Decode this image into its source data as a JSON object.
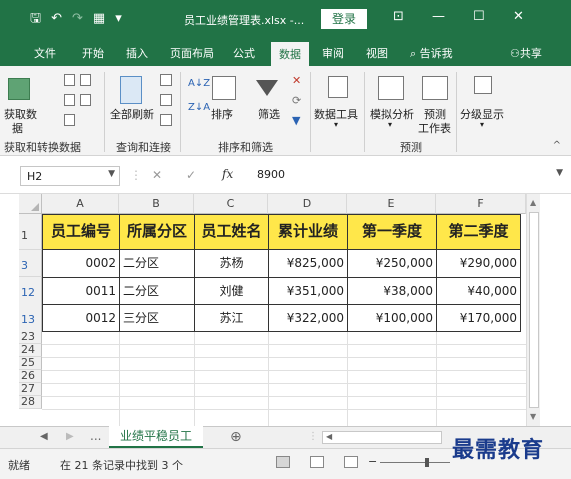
{
  "window": {
    "title": "员工业绩管理表.xlsx  -...",
    "login_label": "登录",
    "ctl_ribbon": "⊡",
    "ctl_minimize": "—",
    "ctl_maximize": "☐",
    "ctl_close": "✕"
  },
  "qat": {
    "save": "🖫",
    "undo": "↶",
    "redo": "↷",
    "open": "▦",
    "customize": "▾"
  },
  "tabs": [
    "文件",
    "开始",
    "插入",
    "页面布局",
    "公式",
    "数据",
    "审阅",
    "视图",
    "告诉我",
    "共享"
  ],
  "active_tab": "数据",
  "ribbon": {
    "groups": [
      "获取和转换数据",
      "查询和连接",
      "排序和筛选",
      "预测"
    ],
    "buttons": {
      "get_data": "获取数",
      "get_data_2": "据",
      "refresh_all": "全部刷新",
      "sort": "排序",
      "filter": "筛选",
      "data_tools": "数据工具",
      "what_if": "模拟分析",
      "forecast": "预测",
      "forecast_2": "工作表",
      "outline": "分级显示"
    },
    "collapse": "^"
  },
  "formula_bar": {
    "name_box": "H2",
    "cancel": "✕",
    "enter": "✓",
    "fx": "fx",
    "value": "8900"
  },
  "sheet": {
    "columns": [
      "A",
      "B",
      "C",
      "D",
      "E",
      "F"
    ],
    "header_row_number": "1",
    "headers": [
      "员工编号",
      "所属分区",
      "员工姓名",
      "累计业绩",
      "第一季度",
      "第二季度"
    ],
    "rows": [
      {
        "num": "3",
        "cells": [
          "0002",
          "二分区",
          "苏杨",
          "¥825,000",
          "¥250,000",
          "¥290,000"
        ]
      },
      {
        "num": "12",
        "cells": [
          "0011",
          "二分区",
          "刘健",
          "¥351,000",
          "¥38,000",
          "¥40,000"
        ]
      },
      {
        "num": "13",
        "cells": [
          "0012",
          "三分区",
          "苏江",
          "¥322,000",
          "¥100,000",
          "¥170,000"
        ]
      }
    ],
    "empty_rows": [
      "23",
      "24",
      "25",
      "26",
      "27",
      "28"
    ]
  },
  "sheet_tabs": {
    "prev": "◀",
    "next": "▶",
    "more": "...",
    "active": "业绩平稳员工",
    "add": "⊕",
    "hscroll_left": "◀"
  },
  "status": {
    "mode": "就绪",
    "message": "在 21 条记录中找到 3 个"
  },
  "watermark": "最需教育"
}
